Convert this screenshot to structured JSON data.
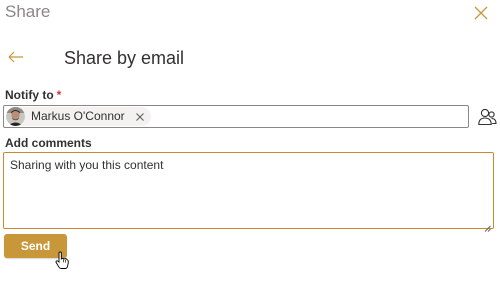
{
  "panel": {
    "title": "Share",
    "close_icon": "close-icon",
    "back_icon": "arrow-left-icon",
    "heading": "Share by email",
    "accent_color": "#c8973a"
  },
  "notify": {
    "label": "Notify to",
    "required_marker": "*",
    "recipients": [
      {
        "name": "Markus O'Connor",
        "avatar_icon": "avatar",
        "remove_icon": "close-icon"
      }
    ],
    "contacts_icon": "people-icon"
  },
  "comments": {
    "label": "Add comments",
    "value": "Sharing with you this content"
  },
  "actions": {
    "send_label": "Send"
  }
}
